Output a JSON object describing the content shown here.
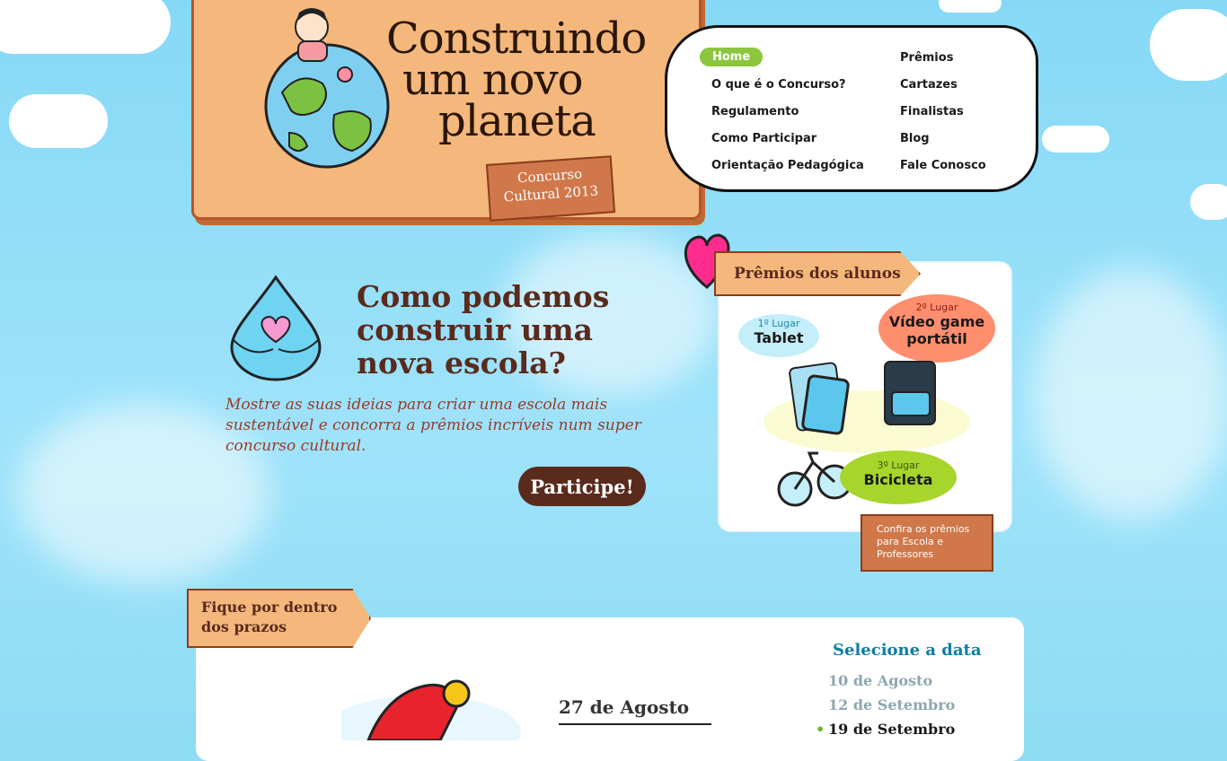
{
  "logo": {
    "title_line1": "Construindo",
    "title_line2": "um novo",
    "title_line3": "planeta",
    "contest_line1": "Concurso",
    "contest_line2": "Cultural 2013"
  },
  "menu": {
    "items": [
      {
        "label": "Home"
      },
      {
        "label": "O que é o Concurso?"
      },
      {
        "label": "Regulamento"
      },
      {
        "label": "Como Participar"
      },
      {
        "label": "Orientação Pedagógica"
      },
      {
        "label": "Prêmios"
      },
      {
        "label": "Cartazes"
      },
      {
        "label": "Finalistas"
      },
      {
        "label": "Blog"
      },
      {
        "label": "Fale Conosco"
      }
    ]
  },
  "hero": {
    "title": "Como podemos construir uma nova escola?",
    "text": "Mostre as suas ideias para criar uma escola mais sustentável e concorra a prêmios incríveis num super concurso cultural.",
    "cta": "Participe!"
  },
  "prizes": {
    "header": "Prêmios dos alunos",
    "first": {
      "rank": "1º Lugar",
      "name": "Tablet"
    },
    "second": {
      "rank": "2º Lugar",
      "name": "Vídeo game portátil"
    },
    "third": {
      "rank": "3º Lugar",
      "name": "Bicicleta"
    },
    "more_link": "Confira os prêmios para Escola e Professores"
  },
  "deadlines": {
    "header_line1": "Fique por dentro",
    "header_line2": "dos prazos",
    "current_date": "27 de Agosto",
    "select_label": "Selecione a data",
    "dates": [
      "10 de Agosto",
      "12 de Setembro",
      "19 de Setembro"
    ]
  },
  "colors": {
    "sky": "#8fdcf5",
    "wood": "#f4b77c",
    "brown_text": "#5a2a1d",
    "accent_green": "#8cc63f",
    "link_blue": "#0e7ea6"
  }
}
